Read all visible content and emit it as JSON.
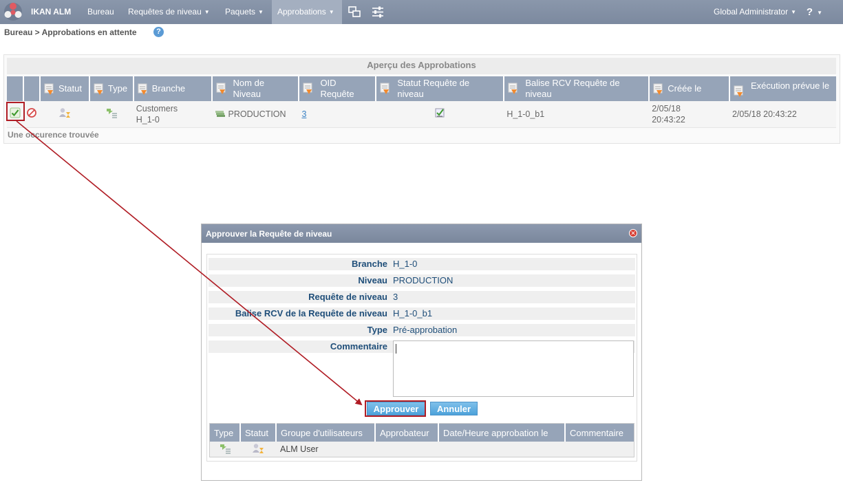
{
  "nav": {
    "brand": "IKAN ALM",
    "items": [
      {
        "label": "Bureau",
        "dropdown": false
      },
      {
        "label": "Requêtes de niveau",
        "dropdown": true
      },
      {
        "label": "Paquets",
        "dropdown": true
      },
      {
        "label": "Approbations",
        "dropdown": true,
        "active": true
      }
    ],
    "icons": [
      "monitor-icon",
      "settings-sliders-icon"
    ],
    "user": "Global Administrator",
    "help": "?"
  },
  "breadcrumb": "Bureau > Approbations en attente",
  "panel": {
    "title": "Aperçu des Approbations",
    "columns": [
      "Statut",
      "Type",
      "Branche",
      "Nom de Niveau",
      "OID Requête",
      "Statut Requête de niveau",
      "Balise RCV Requête de niveau",
      "Créée le",
      "Exécution prévue le"
    ],
    "rows": [
      {
        "branch_line1": "Customers",
        "branch_line2": "H_1-0",
        "level_name": "PRODUCTION",
        "oid": "3",
        "rcv_tag": "H_1-0_b1",
        "created_line1": "2/05/18",
        "created_line2": "20:43:22",
        "scheduled": "2/05/18 20:43:22"
      }
    ],
    "footer": "Une occurence trouvée"
  },
  "dialog": {
    "title": "Approuver la Requête de niveau",
    "fields": [
      {
        "label": "Branche",
        "value": "H_1-0"
      },
      {
        "label": "Niveau",
        "value": "PRODUCTION"
      },
      {
        "label": "Requête de niveau",
        "value": "3"
      },
      {
        "label": "Balise RCV de la Requête de niveau",
        "value": "H_1-0_b1"
      },
      {
        "label": "Type",
        "value": "Pré-approbation"
      },
      {
        "label": "Commentaire",
        "value": ""
      }
    ],
    "approve_label": "Approuver",
    "cancel_label": "Annuler",
    "columns": [
      "Type",
      "Statut",
      "Groupe d'utilisateurs",
      "Approbateur",
      "Date/Heure approbation le",
      "Commentaire"
    ],
    "rows": [
      {
        "group": "ALM User",
        "approver": "",
        "datetime": "",
        "comment": ""
      }
    ]
  },
  "colors": {
    "topbar": "#7f8ca2",
    "table_header": "#96a4b8",
    "label_blue": "#1f4e79",
    "button_blue": "#4da2da",
    "highlight_red": "#b01c24"
  }
}
